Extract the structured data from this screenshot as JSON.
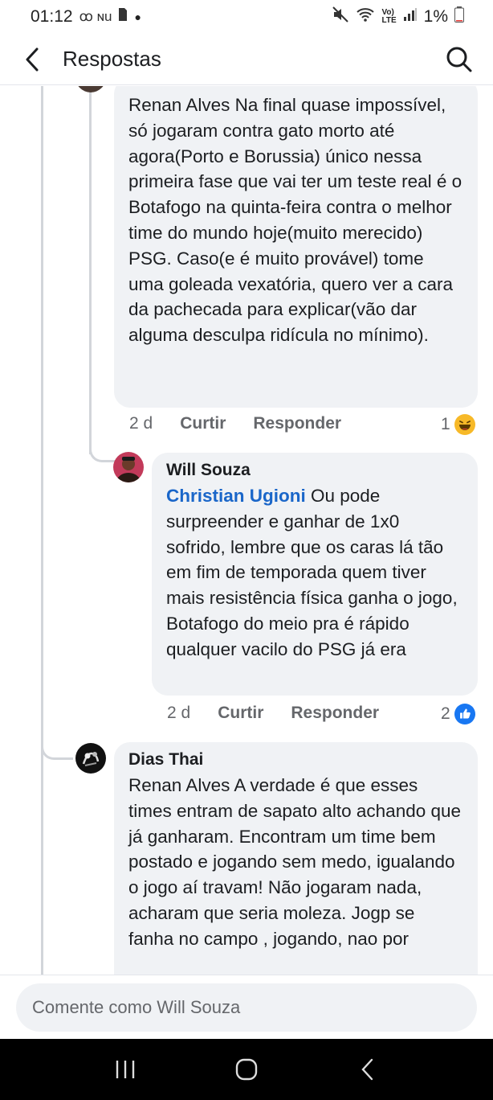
{
  "status_bar": {
    "time": "01:12",
    "left_icons": "ꝏ ɴu",
    "battery": "1%"
  },
  "header": {
    "title": "Respostas"
  },
  "comments": [
    {
      "author": "",
      "mention": "",
      "text": "Renan Alves Na final quase impossível, só jogaram contra gato morto até agora(Porto e Borussia) único nessa primeira fase que vai ter um teste real é o Botafogo na quinta-feira contra o melhor time do mundo hoje(muito merecido) PSG. Caso(e é muito provável) tome uma goleada vexatória, quero ver a cara da pachecada para explicar(vão dar alguma desculpa ridícula no mínimo).",
      "time": "2 d",
      "like": "Curtir",
      "reply": "Responder",
      "reaction_count": "1",
      "reaction_icon": "haha-icon"
    },
    {
      "author": "Will Souza",
      "mention": "Christian Ugioni",
      "text": " Ou pode surpreender e ganhar de 1x0 sofrido, lembre que os caras lá tão em fim de temporada quem tiver mais resistência física ganha o jogo, Botafogo do meio pra é rápido qualquer vacilo do PSG já era",
      "time": "2 d",
      "like": "Curtir",
      "reply": "Responder",
      "reaction_count": "2",
      "reaction_icon": "like-icon"
    },
    {
      "author": "Dias Thai",
      "mention": "",
      "text": "Renan Alves A verdade é que esses times entram de sapato alto achando que já ganharam. Encontram um time bem postado e jogando sem medo, igualando o jogo aí travam! Não jogaram nada, acharam que seria moleza. Jogp se fanha no campo , jogando, nao por"
    }
  ],
  "composer": {
    "placeholder": "Comente como Will Souza"
  },
  "colors": {
    "mention": "#1a66c9",
    "bubble": "#f0f2f5",
    "like_blue": "#1877f2",
    "haha_yellow": "#f7b928"
  }
}
